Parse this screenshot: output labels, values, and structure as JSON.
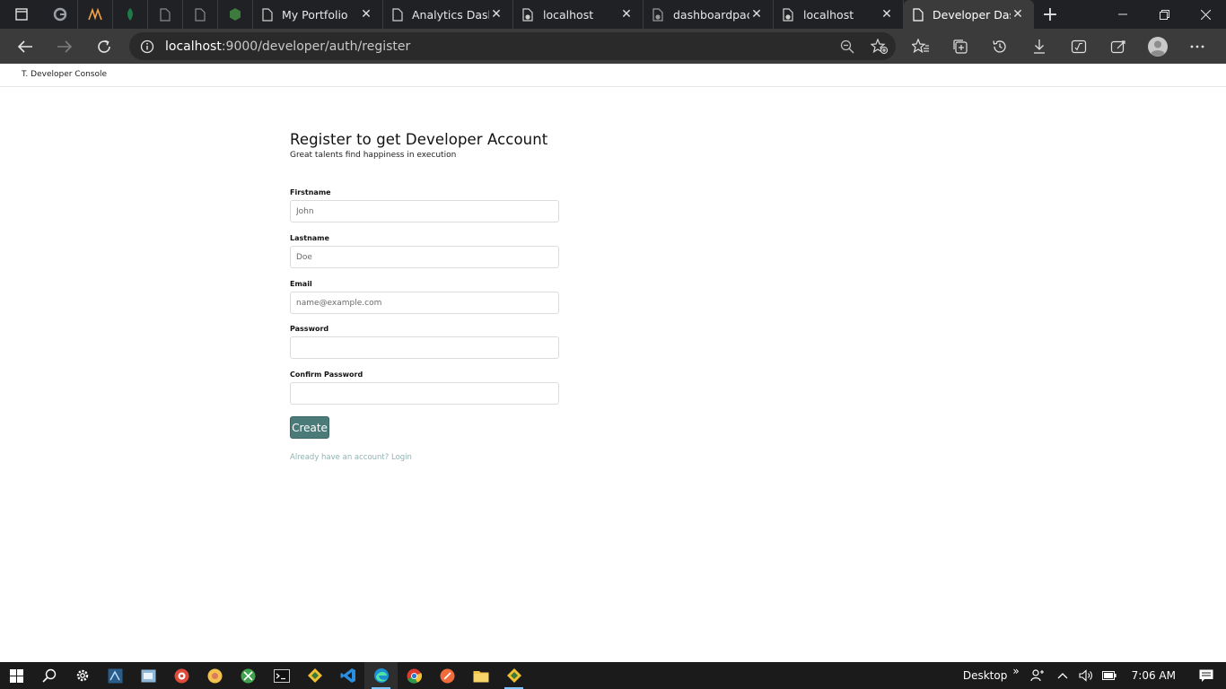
{
  "browser": {
    "tabs": [
      {
        "title": "My Portfolio",
        "active": false
      },
      {
        "title": "Analytics Dashb",
        "active": false
      },
      {
        "title": "localhost",
        "active": false
      },
      {
        "title": "dashboardpack",
        "active": false
      },
      {
        "title": "localhost",
        "active": false
      },
      {
        "title": "Developer Das",
        "active": true
      }
    ],
    "close_glyph": "✕",
    "new_tab_glyph": "+",
    "url_host": "localhost",
    "url_path": ":9000/developer/auth/register"
  },
  "page": {
    "brand": "T. Developer Console",
    "title": "Register to get Developer Account",
    "subtitle": "Great talents find happiness in execution",
    "fields": {
      "firstname": {
        "label": "Firstname",
        "placeholder": "John"
      },
      "lastname": {
        "label": "Lastname",
        "placeholder": "Doe"
      },
      "email": {
        "label": "Email",
        "placeholder": "name@example.com"
      },
      "password": {
        "label": "Password",
        "placeholder": ""
      },
      "confirm": {
        "label": "Confirm Password",
        "placeholder": ""
      }
    },
    "create_label": "Create",
    "login_link": "Already have an account? Login"
  },
  "taskbar": {
    "desktop_label": "Desktop",
    "chevron": "»",
    "time": "7:06 AM"
  },
  "colors": {
    "accent_button": "#4b7b78",
    "link": "#8fb2b0",
    "tabstrip": "#202124",
    "toolbar": "#3b3b3b"
  }
}
